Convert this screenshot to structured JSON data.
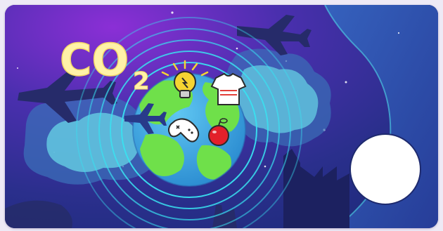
{
  "card": {
    "illustration": {
      "co2_main": "CO",
      "co2_sub": "2",
      "colors": {
        "bg_top_left": "#8b2fd6",
        "bg_deep": "#1d2a7a",
        "bg_mid": "#3b3aa8",
        "cloud": "#63c8e0",
        "cloud_dark": "#3b6fb8",
        "rings": "#39e0f0",
        "ocean": "#33a8e0",
        "land": "#6fe04a",
        "co2_text": "#fff2a8",
        "silhouette": "#262b6a",
        "panel": "#2f55b0"
      },
      "icons": [
        "lightbulb-icon",
        "tshirt-icon",
        "game-controller-icon",
        "apple-icon",
        "airplane-icon",
        "factory-icon"
      ]
    },
    "action": {
      "button_state": "empty-circle"
    }
  }
}
